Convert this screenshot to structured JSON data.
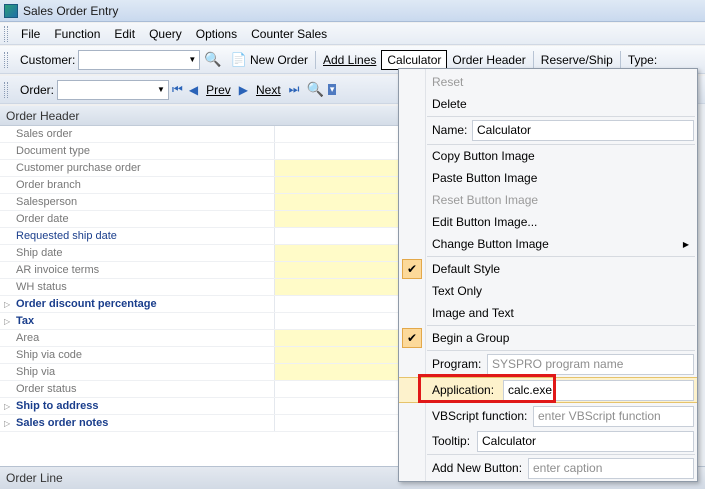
{
  "window": {
    "title": "Sales Order Entry"
  },
  "menu": [
    "File",
    "Function",
    "Edit",
    "Query",
    "Options",
    "Counter Sales"
  ],
  "toolbar1": {
    "customer_label": "Customer:",
    "customer_value": "",
    "new_order": "New Order",
    "add_lines": "Add Lines",
    "calculator": "Calculator",
    "order_header": "Order Header",
    "reserve_ship": "Reserve/Ship",
    "type": "Type:"
  },
  "toolbar2": {
    "order_label": "Order:",
    "prev": "Prev",
    "next": "Next"
  },
  "panel": {
    "title": "Order Header",
    "rows": [
      {
        "label": "Sales order",
        "kind": "plain",
        "yellow": false
      },
      {
        "label": "Document type",
        "kind": "plain",
        "yellow": false
      },
      {
        "label": "Customer purchase order",
        "kind": "plain",
        "yellow": true
      },
      {
        "label": "Order branch",
        "kind": "plain",
        "yellow": true
      },
      {
        "label": "Salesperson",
        "kind": "plain",
        "yellow": true
      },
      {
        "label": "Order date",
        "kind": "plain",
        "yellow": true
      },
      {
        "label": "Requested ship date",
        "kind": "req",
        "yellow": false
      },
      {
        "label": "Ship date",
        "kind": "plain",
        "yellow": true
      },
      {
        "label": "AR invoice terms",
        "kind": "plain",
        "yellow": true
      },
      {
        "label": "WH status",
        "kind": "plain",
        "yellow": true
      },
      {
        "label": "Order discount percentage",
        "kind": "grp",
        "yellow": false
      },
      {
        "label": "Tax",
        "kind": "grp",
        "yellow": false
      },
      {
        "label": "Area",
        "kind": "plain",
        "yellow": true
      },
      {
        "label": "Ship via code",
        "kind": "plain",
        "yellow": true
      },
      {
        "label": "Ship via",
        "kind": "plain",
        "yellow": true
      },
      {
        "label": "Order status",
        "kind": "plain",
        "yellow": false
      },
      {
        "label": "Ship to address",
        "kind": "grp",
        "yellow": false
      },
      {
        "label": "Sales order notes",
        "kind": "grp",
        "yellow": false
      }
    ]
  },
  "bottom": {
    "label": "Order Line"
  },
  "context_menu": {
    "reset": "Reset",
    "delete": "Delete",
    "name_label": "Name:",
    "name_value": "Calculator",
    "copy_image": "Copy Button Image",
    "paste_image": "Paste Button Image",
    "reset_image": "Reset Button Image",
    "edit_image": "Edit Button Image...",
    "change_image": "Change Button Image",
    "default_style": "Default Style",
    "text_only": "Text Only",
    "image_and_text": "Image and Text",
    "begin_group": "Begin a Group",
    "program_label": "Program:",
    "program_placeholder": "SYSPRO program name",
    "application_label": "Application:",
    "application_value": "calc.exe",
    "vbscript_label": "VBScript function:",
    "vbscript_placeholder": "enter VBScript function",
    "tooltip_label": "Tooltip:",
    "tooltip_value": "Calculator",
    "add_button_label": "Add New Button:",
    "add_button_placeholder": "enter caption"
  },
  "colors": {
    "highlight": "#fdf2cc",
    "check_bg": "#fcd99a",
    "required_field": "#fffbc8",
    "annotation": "#e01818"
  }
}
